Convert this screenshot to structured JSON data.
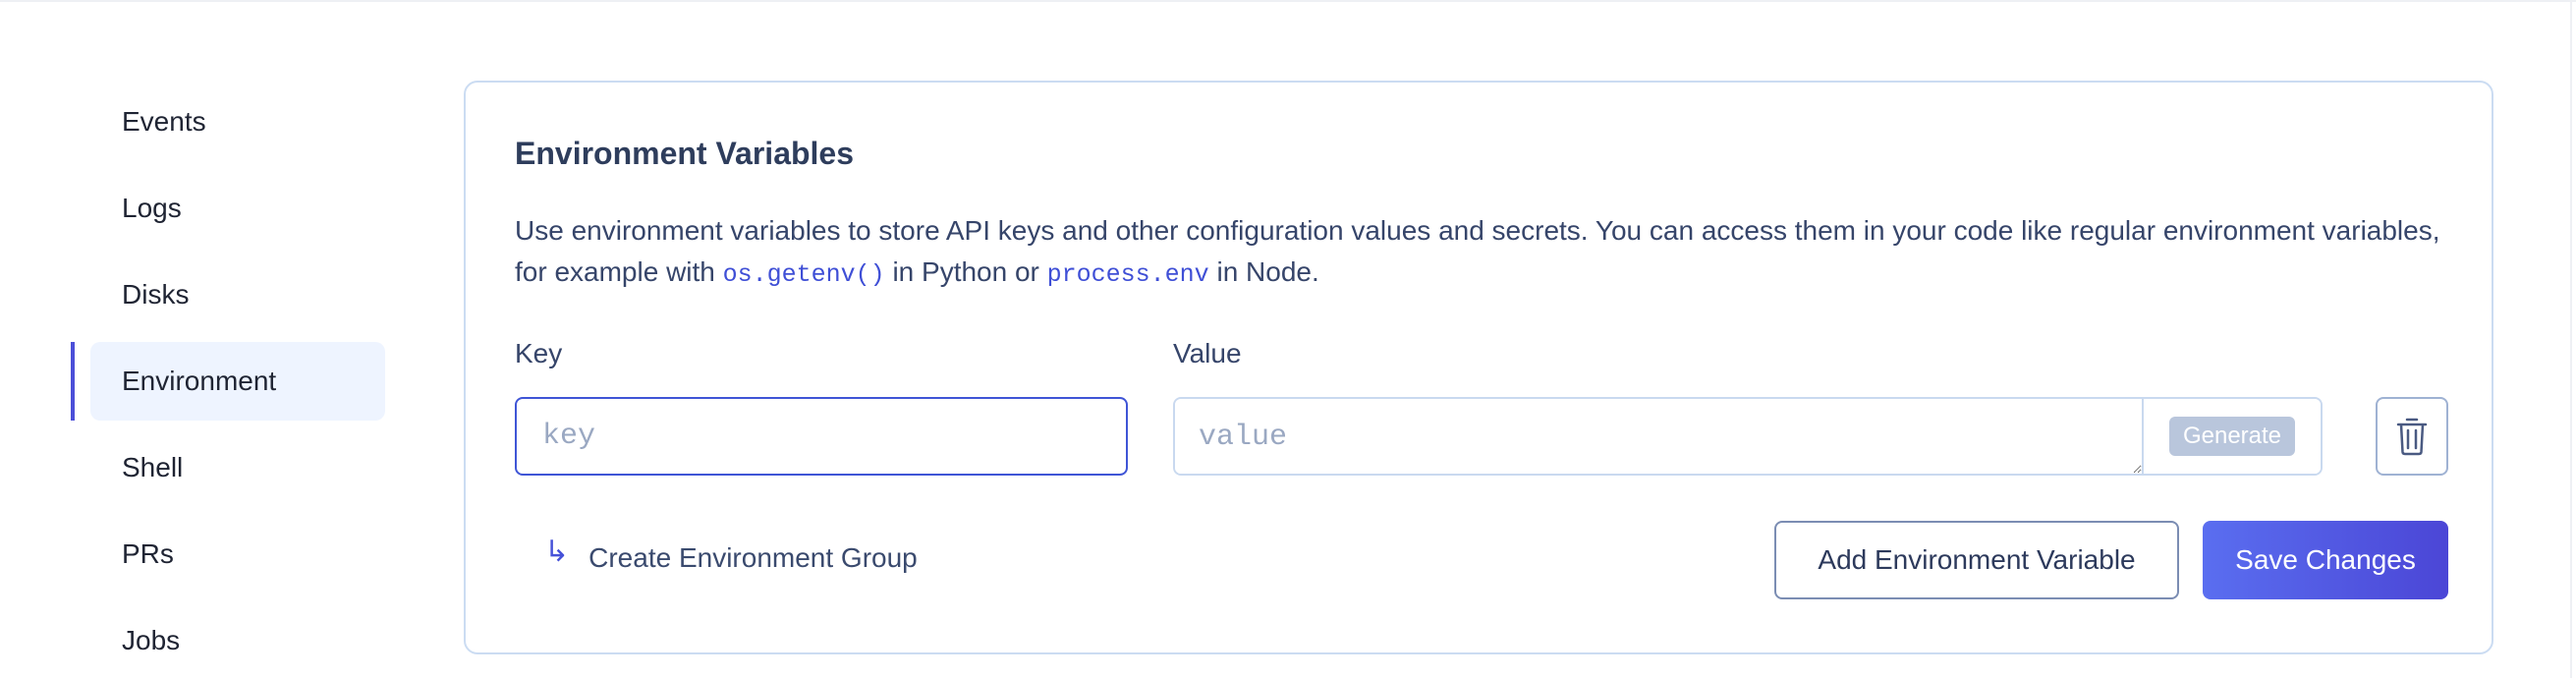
{
  "sidebar": {
    "items": [
      {
        "label": "Events",
        "active": false
      },
      {
        "label": "Logs",
        "active": false
      },
      {
        "label": "Disks",
        "active": false
      },
      {
        "label": "Environment",
        "active": true
      },
      {
        "label": "Shell",
        "active": false
      },
      {
        "label": "PRs",
        "active": false
      },
      {
        "label": "Jobs",
        "active": false
      }
    ]
  },
  "env": {
    "title": "Environment Variables",
    "description_part1": "Use environment variables to store API keys and other configuration values and secrets. You can access them in your code like regular environment variables, for example with ",
    "code1": "os.getenv()",
    "description_part2": " in Python or ",
    "code2": "process.env",
    "description_part3": " in Node.",
    "key_label": "Key",
    "value_label": "Value",
    "key_placeholder": "key",
    "value_placeholder": "value",
    "key_value": "",
    "value_value": "",
    "generate_label": "Generate",
    "delete_icon": "trash-icon",
    "create_group_icon": "return-arrow-icon",
    "create_group_label": "Create Environment Group",
    "add_button_label": "Add Environment Variable",
    "save_button_label": "Save Changes"
  },
  "colors": {
    "accent": "#4b4fd8",
    "active_bg": "#eef4ff",
    "border": "#cbdcf2",
    "save_gradient_start": "#5a6ef0",
    "save_gradient_end": "#4b46d6"
  }
}
